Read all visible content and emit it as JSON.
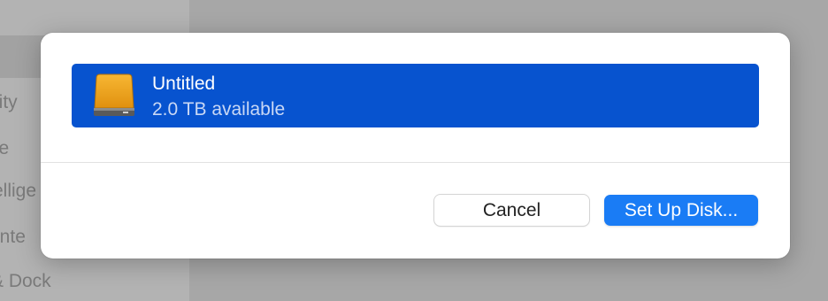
{
  "background": {
    "sidebar_items": [
      "lity",
      "ce",
      "ellige",
      "ente",
      "& Dock"
    ]
  },
  "dialog": {
    "disk": {
      "name": "Untitled",
      "available": "2.0 TB available",
      "icon": "external-drive-icon"
    },
    "buttons": {
      "cancel_label": "Cancel",
      "setup_label": "Set Up Disk..."
    }
  },
  "colors": {
    "selection": "#0753cf",
    "primary_button": "#1a7cf5",
    "drive_orange": "#f0a51d"
  }
}
